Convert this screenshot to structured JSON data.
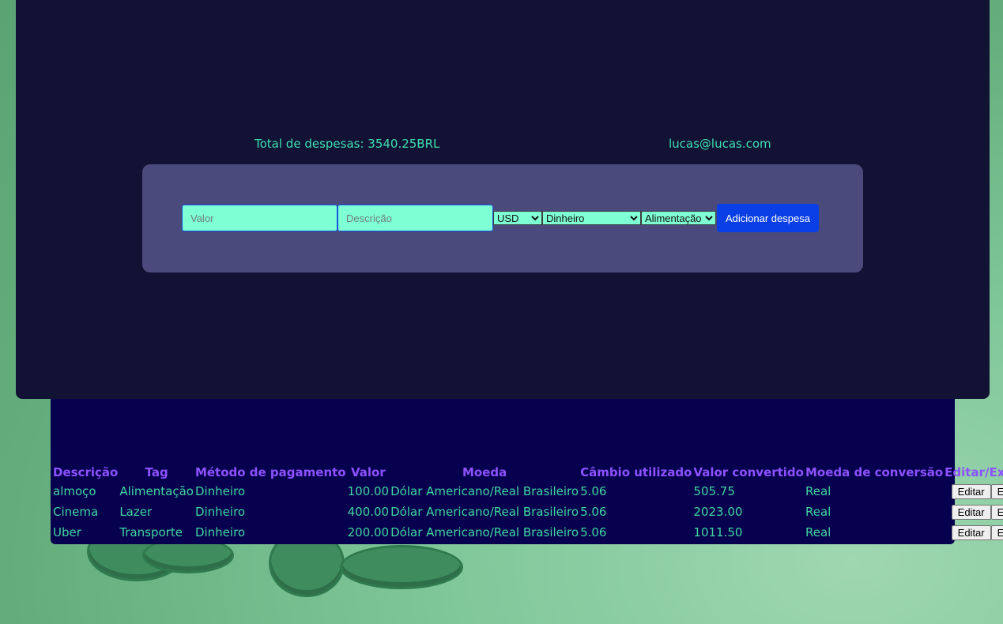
{
  "summary": {
    "total_label": "Total de despesas: 3540.25BRL",
    "email": "lucas@lucas.com"
  },
  "form": {
    "value_placeholder": "Valor",
    "description_placeholder": "Descrição",
    "currency_selected": "USD",
    "method_selected": "Dinheiro",
    "tag_selected": "Alimentação",
    "add_button": "Adicionar despesa"
  },
  "table": {
    "headers": [
      "Descrição",
      "Tag",
      "Método de pagamento",
      "Valor",
      "Moeda",
      "Câmbio utilizado",
      "Valor convertido",
      "Moeda de conversão",
      "Editar/Excluir"
    ],
    "rows": [
      {
        "description": "almoço",
        "tag": "Alimentação",
        "method": "Dinheiro",
        "value": "100.00",
        "currency": "Dólar Americano/Real Brasileiro",
        "rate": "5.06",
        "converted": "505.75",
        "conversion_currency": "Real",
        "edit": "Editar",
        "delete": "Excluir"
      },
      {
        "description": "Cinema",
        "tag": "Lazer",
        "method": "Dinheiro",
        "value": "400.00",
        "currency": "Dólar Americano/Real Brasileiro",
        "rate": "5.06",
        "converted": "2023.00",
        "conversion_currency": "Real",
        "edit": "Editar",
        "delete": "Excluir"
      },
      {
        "description": "Uber",
        "tag": "Transporte",
        "method": "Dinheiro",
        "value": "200.00",
        "currency": "Dólar Americano/Real Brasileiro",
        "rate": "5.06",
        "converted": "1011.50",
        "conversion_currency": "Real",
        "edit": "Editar",
        "delete": "Excluir"
      }
    ]
  },
  "colors": {
    "header_bg": "#111234",
    "form_bg": "#4b4a7c",
    "table_bg": "#07004f",
    "accent_text": "#3fd7a0",
    "header_text": "#8c52ff",
    "button_blue": "#0a3fe6"
  }
}
